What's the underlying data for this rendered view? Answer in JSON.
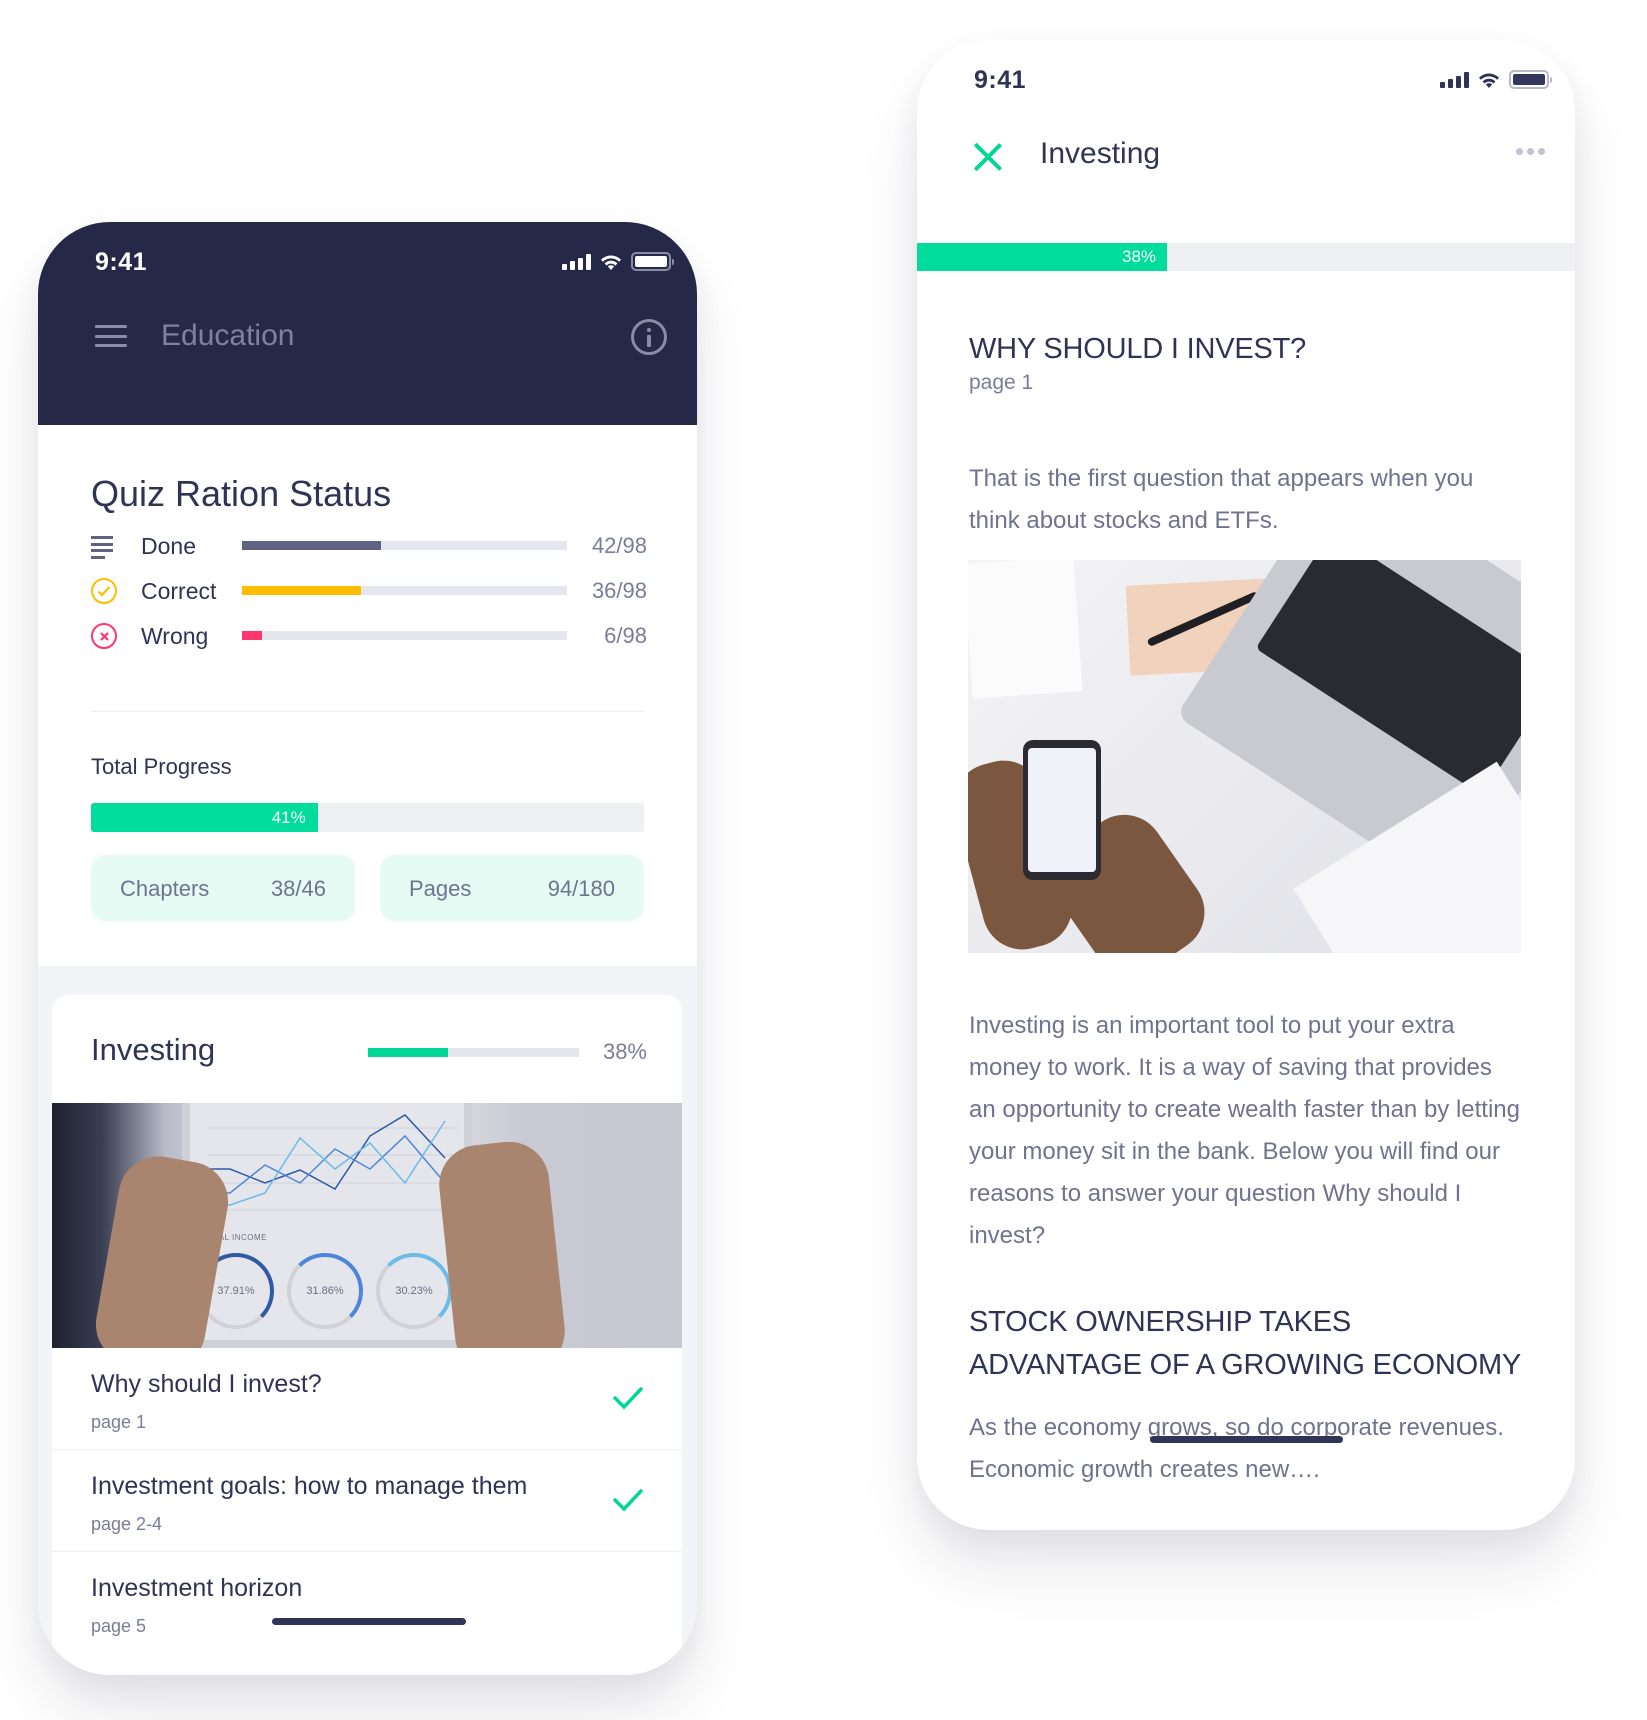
{
  "left_phone": {
    "status_time": "9:41",
    "header": {
      "title": "Education",
      "menu_icon": "hamburger-menu-icon",
      "info_icon": "info-icon"
    },
    "quiz": {
      "title": "Quiz Ration Status",
      "rows": [
        {
          "label": "Done",
          "value": "42/98",
          "fraction": 0.4286,
          "color": "#5f6283",
          "icon": "list-lines-icon"
        },
        {
          "label": "Correct",
          "value": "36/98",
          "fraction": 0.3673,
          "color": "#ffbd00",
          "icon": "check-circle-icon"
        },
        {
          "label": "Wrong",
          "value": "6/98",
          "fraction": 0.0612,
          "color": "#ff3670",
          "icon": "x-circle-icon"
        }
      ],
      "total_progress_label": "Total Progress",
      "total_progress_text": "41%",
      "total_progress_percent": 41,
      "chips": [
        {
          "label": "Chapters",
          "value": "38/46"
        },
        {
          "label": "Pages",
          "value": "94/180"
        }
      ]
    },
    "course_card": {
      "title": "Investing",
      "progress_text": "38%",
      "progress_percent": 38,
      "image_alt": "Hands holding tablet with line chart and income rings",
      "image_texts": {
        "total_income": "TOTAL INCOME",
        "rings": [
          "37.91%",
          "31.86%",
          "30.23%"
        ]
      },
      "lessons": [
        {
          "title": "Why should I invest?",
          "page": "page 1",
          "completed": true
        },
        {
          "title": "Investment goals: how to manage them",
          "page": "page 2-4",
          "completed": true
        },
        {
          "title": "Investment horizon",
          "page": "page 5",
          "completed": false
        }
      ]
    }
  },
  "right_phone": {
    "status_time": "9:41",
    "header": {
      "title": "Investing",
      "close_icon": "close-icon",
      "more_icon": "more-dots-icon"
    },
    "progress_text": "38%",
    "progress_percent": 38,
    "article": {
      "heading": "WHY SHOULD I INVEST?",
      "page": "page 1",
      "intro": "That is the first question that appears when you think about stocks and ETFs.",
      "image_alt": "Person using smartphone at desk with laptop, cashbook and documents",
      "body": "Investing is an important tool to put your extra money to work. It is a way of saving that provides an opportunity to create wealth faster than by letting your money sit in the bank. Below you will find our reasons to answer your question Why should I invest?",
      "subheading": "STOCK OWNERSHIP TAKES ADVANTAGE OF A GROWING ECONOMY",
      "teaser": "As the economy grows, so do corporate revenues. Economic growth creates new…."
    }
  },
  "colors": {
    "navy": "#262847",
    "accent_green": "#00dc9c",
    "correct_yellow": "#ffbd00",
    "wrong_pink": "#ff3670",
    "text_primary": "#2f3356",
    "text_secondary": "#7a7d98"
  }
}
